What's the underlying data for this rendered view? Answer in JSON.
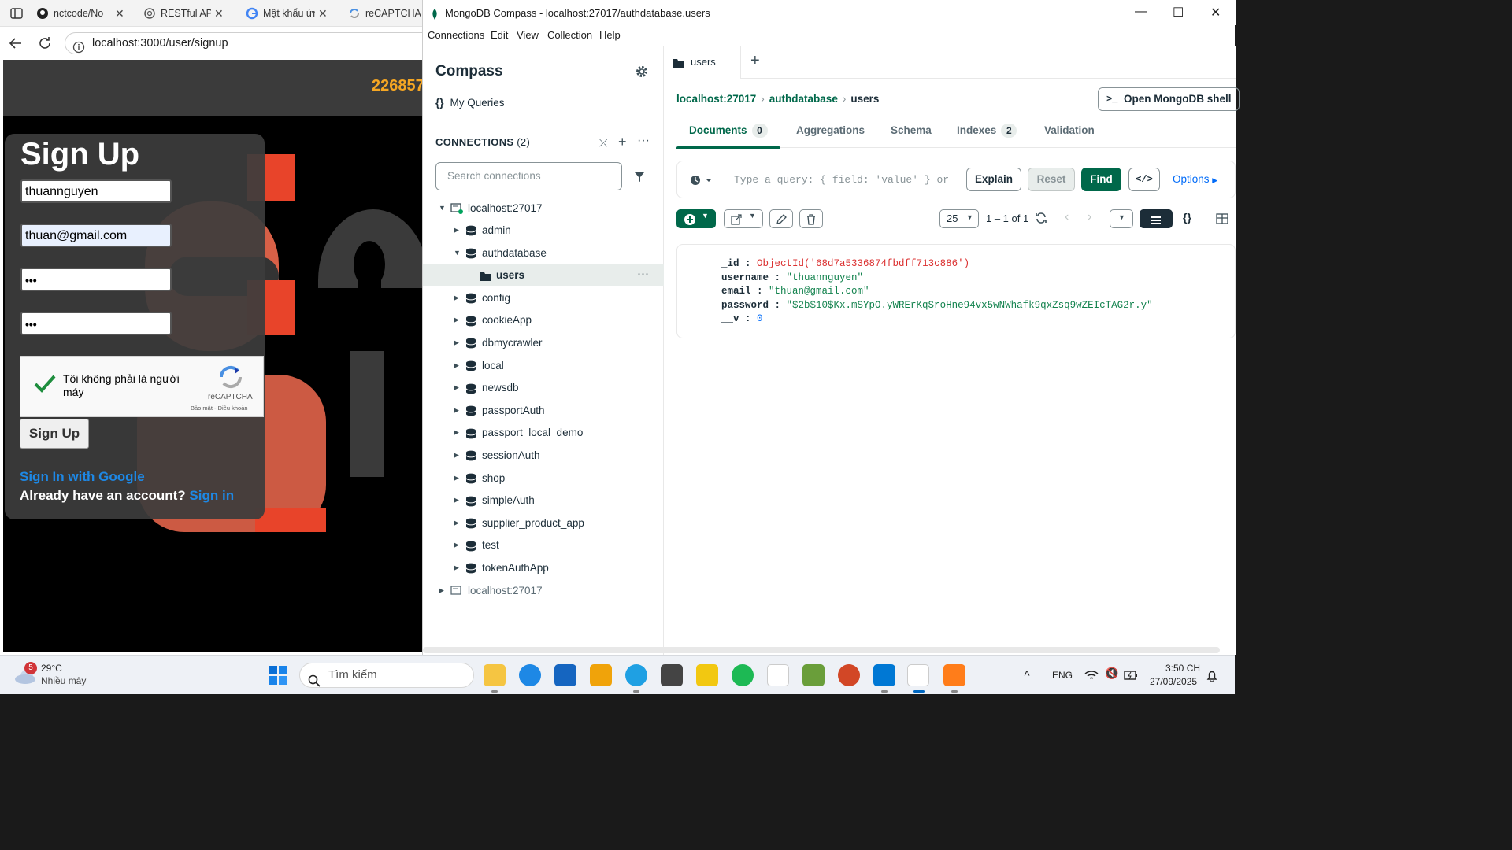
{
  "browser": {
    "tabs": [
      {
        "label": "nctcode/No",
        "icon": "github-icon"
      },
      {
        "label": "RESTful API",
        "icon": "openai-icon"
      },
      {
        "label": "Mật khẩu ứn",
        "icon": "google-icon"
      },
      {
        "label": "reCAPTCHA",
        "icon": "recaptcha-icon"
      }
    ],
    "url": "localhost:3000/user/signup"
  },
  "webpage": {
    "header_number": "226857",
    "signup_title": "Sign Up",
    "username_value": "thuannguyen",
    "email_value": "thuan@gmail.com",
    "password_mask": "•••",
    "confirm_mask": "•••",
    "recaptcha": {
      "label": "Tôi không phải là người máy",
      "brand": "reCAPTCHA",
      "links": "Bảo mật - Điều khoản"
    },
    "submit_label": "Sign Up",
    "google_link": "Sign In with Google",
    "already_text": "Already have an account?",
    "signin_link": "Sign in"
  },
  "compass": {
    "window_title": "MongoDB Compass - localhost:27017/authdatabase.users",
    "menu": [
      "Connections",
      "Edit",
      "View",
      "Collection",
      "Help"
    ],
    "sidebar": {
      "title": "Compass",
      "my_queries": "My Queries",
      "connections_label": "CONNECTIONS",
      "connections_count": "(2)",
      "search_placeholder": "Search connections",
      "connection_1": "localhost:27017",
      "connection_2": "localhost:27017",
      "databases": [
        "admin",
        "authdatabase",
        "config",
        "cookieApp",
        "dbmycrawler",
        "local",
        "newsdb",
        "passportAuth",
        "passport_local_demo",
        "sessionAuth",
        "shop",
        "simpleAuth",
        "supplier_product_app",
        "test",
        "tokenAuthApp"
      ],
      "selected_collection": "users"
    },
    "tab_label": "users",
    "breadcrumb": {
      "host": "localhost:27017",
      "db": "authdatabase",
      "coll": "users"
    },
    "shell_button": "Open MongoDB shell",
    "subtabs": [
      {
        "label": "Documents",
        "badge": "0"
      },
      {
        "label": "Aggregations",
        "badge": ""
      },
      {
        "label": "Schema",
        "badge": ""
      },
      {
        "label": "Indexes",
        "badge": "2"
      },
      {
        "label": "Validation",
        "badge": ""
      }
    ],
    "query_placeholder": "Type a query: { field: 'value' } or",
    "explain_label": "Explain",
    "reset_label": "Reset",
    "find_label": "Find",
    "options_label": "Options",
    "page_size": "25",
    "range": "1 – 1 of 1",
    "document": {
      "id_key": "_id",
      "id_value": "ObjectId('68d7a5336874fbdff713c886')",
      "username_key": "username",
      "username_value": "\"thuannguyen\"",
      "email_key": "email",
      "email_value": "\"thuan@gmail.com\"",
      "password_key": "password",
      "password_value": "\"$2b$10$Kx.mSYpO.yWRErKqSroHne94vx5wNWhafk9qxZsq9wZEIcTAG2r.y\"",
      "v_key": "__v",
      "v_value": "0"
    }
  },
  "taskbar": {
    "weather_badge": "5",
    "temperature": "29°C",
    "weather": "Nhiều mây",
    "search_placeholder": "Tìm kiếm",
    "lang": "ENG",
    "time": "3:50 CH",
    "date": "27/09/2025"
  },
  "colors": {
    "mongo_green": "#00684a",
    "find_green": "#00684a",
    "link_blue": "#1e88e5",
    "accent_orange": "#f5a623"
  }
}
